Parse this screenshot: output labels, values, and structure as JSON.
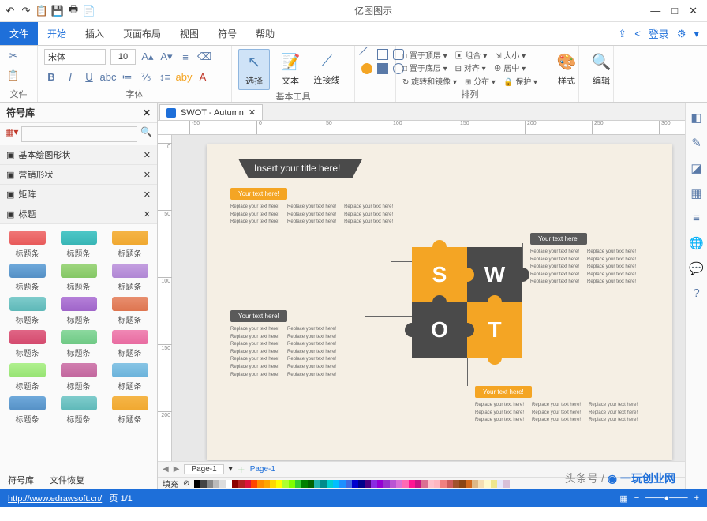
{
  "app_title": "亿图图示",
  "win": {
    "min": "—",
    "max": "□",
    "close": "✕"
  },
  "qat": [
    "↶",
    "↷",
    "📋",
    "💾",
    "🖶",
    "📄"
  ],
  "tabs": {
    "file": "文件",
    "items": [
      "开始",
      "插入",
      "页面布局",
      "视图",
      "符号",
      "帮助"
    ],
    "active": "开始",
    "right": {
      "login": "登录",
      "share": "⇪",
      "cloud": "☁",
      "gear": "⚙"
    }
  },
  "ribbon": {
    "file_group": "文件",
    "font_group": "字体",
    "font_name": "宋体",
    "font_size": "10",
    "tools_group": "基本工具",
    "tool_select": "选择",
    "tool_text": "文本",
    "tool_connector": "连接线",
    "arrange_group": "排列",
    "arrange": {
      "top": "置于顶层",
      "bottom": "置于底层",
      "rotate": "旋转和镜像",
      "group": "组合",
      "align": "对齐",
      "distribute": "分布",
      "size": "大小",
      "center": "居中",
      "lock": "保护"
    },
    "style_group": "样式",
    "edit_group": "编辑"
  },
  "sidebar": {
    "title": "符号库",
    "categories": [
      "基本绘图形状",
      "营销形状",
      "矩阵",
      "标题"
    ],
    "shape_label": "标题条",
    "footer": [
      "符号库",
      "文件恢复"
    ]
  },
  "doc": {
    "tab_name": "SWOT - Autumn"
  },
  "canvas": {
    "title_banner": "Insert your title here!",
    "your_text": "Your text here!",
    "replace": "Replace your text here!",
    "swot": [
      "S",
      "W",
      "O",
      "T"
    ]
  },
  "page_tabs": {
    "page": "Page-1"
  },
  "colorbar": {
    "label": "填充"
  },
  "status": {
    "url": "http://www.edrawsoft.cn/",
    "page_text": "页 1/1"
  },
  "watermark": {
    "t1": "头条号",
    "t2": "一玩创业网"
  },
  "ruler_marks": [
    -50,
    0,
    50,
    100,
    150,
    200,
    250,
    300
  ],
  "ruler_v": [
    0,
    50,
    100,
    150,
    200
  ]
}
